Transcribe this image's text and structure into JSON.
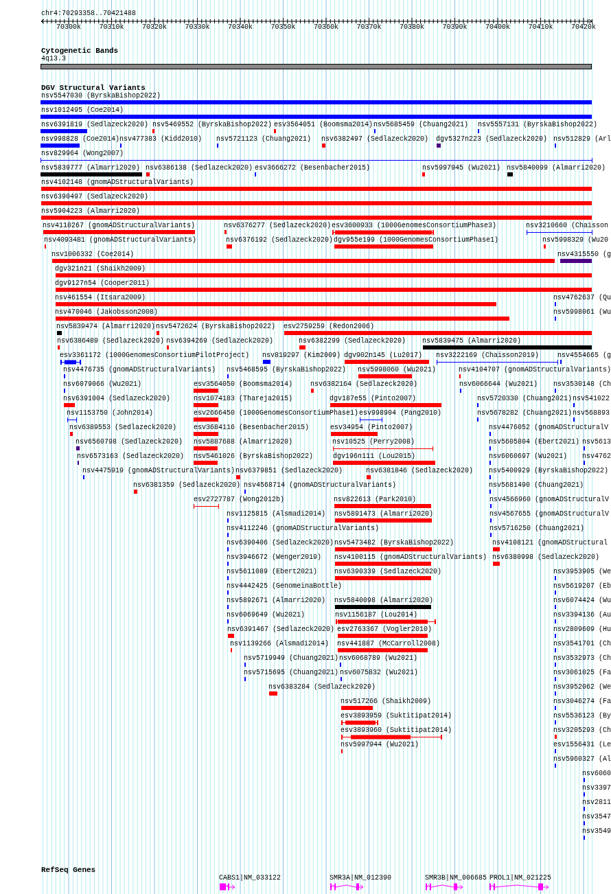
{
  "ruler": {
    "region": "chr4:70293358..70421488",
    "ticks": [
      "70300k",
      "70310k",
      "70320k",
      "70330k",
      "70340k",
      "70350k",
      "70360k",
      "70370k",
      "70380k",
      "70390k",
      "70400k",
      "70410k",
      "70420k"
    ]
  },
  "cytogenetic_bands": {
    "title": "Cytogenetic Bands",
    "band": "4q13.3"
  },
  "variants": {
    "title": "DGV Structural Variants",
    "features": [
      {
        "label": "nsv5547030 (ByrskaBishop2022)",
        "color": "#0000ff",
        "kind": "bar"
      },
      {
        "label": "nsv1012495 (Coe2014)",
        "color": "#0000ff",
        "kind": "bar"
      },
      {
        "label": "nsv6391819 (Sedlazeck2020)",
        "color": "#0000ff",
        "kind": "bar"
      },
      {
        "label": "nsv5469552 (ByrskaBishop2022)",
        "color": "#ff0000",
        "kind": "bar"
      },
      {
        "label": "esv3564051 (Boomsma2014)",
        "color": "#ff0000",
        "kind": "bar"
      },
      {
        "label": "nsv5685459 (Chuang2021)",
        "color": "#0000ff",
        "kind": "bar"
      },
      {
        "label": "nsv5557131 (ByrskaBishop2022)",
        "color": "#0000ff",
        "kind": "bar"
      },
      {
        "label": "nsv998828 (Coe2014)",
        "color": "#0000ff",
        "kind": "bar"
      },
      {
        "label": "nsv477383 (Kidd2010)",
        "color": "#0000ff",
        "kind": "bar"
      },
      {
        "label": "nsv5721123 (Chuang2021)",
        "color": "#0000ff",
        "kind": "bar"
      },
      {
        "label": "nsv6382497 (Sedlazeck2020)",
        "color": "#ff0000",
        "kind": "bar"
      },
      {
        "label": "dgv5327n223 (Sedlazeck2020)",
        "color": "#4b0082",
        "kind": "bar"
      },
      {
        "label": "nsv512829 (Arl",
        "color": "#0000ff",
        "kind": "bar"
      },
      {
        "label": "nsv829964 (Wong2007)",
        "color": "#0000ff",
        "kind": "line"
      },
      {
        "label": "nsv5839777 (Almarri2020)",
        "color": "#000000",
        "kind": "bar"
      },
      {
        "label": "nsv6386138 (Sedlazeck2020)",
        "color": "#ff0000",
        "kind": "bar"
      },
      {
        "label": "esv3666272 (Besenbacher2015)",
        "color": "#0000ff",
        "kind": "bar"
      },
      {
        "label": "nsv5997945 (Wu2021)",
        "color": "#ff0000",
        "kind": "bar"
      },
      {
        "label": "nsv5840099 (Almarri2020)",
        "color": "#000000",
        "kind": "bar"
      },
      {
        "label": "nsv4102148 (gnomADStructuralVariants)",
        "color": "#ff0000",
        "kind": "bar"
      },
      {
        "label": "nsv6390497 (Sedlazeck2020)",
        "color": "#ff0000",
        "kind": "bar"
      },
      {
        "label": "nsv5904223 (Almarri2020)",
        "color": "#ff0000",
        "kind": "bar"
      },
      {
        "label": "nsv4110267 (gnomADStructuralVariants)",
        "color": "#ff0000",
        "kind": "bar"
      },
      {
        "label": "nsv6376277 (Sedlazeck2020)",
        "color": "#ff0000",
        "kind": "bar"
      },
      {
        "label": "esv3600933 (1000GenomesConsortiumPhase3)",
        "color": "#ff0000",
        "kind": "capped-bar"
      },
      {
        "label": "nsv3210660 (Chaisson",
        "color": "#0000ff",
        "kind": "line"
      },
      {
        "label": "nsv4093481 (gnomADStructuralVariants)",
        "color": "#ff0000",
        "kind": "bar"
      },
      {
        "label": "nsv6376192 (Sedlazeck2020)",
        "color": "#ff0000",
        "kind": "bar"
      },
      {
        "label": "dgv955e199 (1000GenomesConsortiumPhase1)",
        "color": "#ff0000",
        "kind": "bar"
      },
      {
        "label": "nsv5998329 (Wu20",
        "color": "#ff0000",
        "kind": "bar"
      },
      {
        "label": "nsv1006332 (Coe2014)",
        "color": "#ff0000",
        "kind": "bar"
      },
      {
        "label": "nsv4315550 (g",
        "color": "#4b0082",
        "kind": "bar"
      },
      {
        "label": "dgv321n21 (Shaikh2009)",
        "color": "#ff0000",
        "kind": "bar"
      },
      {
        "label": "dgv9127n54 (Cooper2011)",
        "color": "#ff0000",
        "kind": "bar"
      },
      {
        "label": "nsv461554 (Itsara2009)",
        "color": "#ff0000",
        "kind": "bar"
      },
      {
        "label": "nsv4762637 (Qu",
        "color": "#0000ff",
        "kind": "bar"
      },
      {
        "label": "nsv470046 (Jakobsson2008)",
        "color": "#ff0000",
        "kind": "bar"
      },
      {
        "label": "nsv5998061 (Wu",
        "color": "#0000ff",
        "kind": "bar"
      },
      {
        "label": "nsv5839474 (Almarri2020)",
        "color": "#000000",
        "kind": "bar"
      },
      {
        "label": "nsv5472624 (ByrskaBishop2022)",
        "color": "#ff0000",
        "kind": "bar"
      },
      {
        "label": "esv2759259 (Redon2006)",
        "color": "#ff0000",
        "kind": "bar"
      },
      {
        "label": "nsv6386489 (Sedlazeck2020)",
        "color": "#ff0000",
        "kind": "bar"
      },
      {
        "label": "nsv6394269 (Sedlazeck2020)",
        "color": "#ff0000",
        "kind": "bar"
      },
      {
        "label": "nsv6382299 (Sedlazeck2020)",
        "color": "#ff0000",
        "kind": "bar"
      },
      {
        "label": "nsv5839475 (Almarri2020)",
        "color": "#000000",
        "kind": "bar"
      },
      {
        "label": "esv3361172 (1000GenomesConsortiumPilotProject)",
        "color": "#0000ff",
        "kind": "capped-bar"
      },
      {
        "label": "nsv819297 (Kim2009)",
        "color": "#0000ff",
        "kind": "bar"
      },
      {
        "label": "dgv902n145 (Lu2017)",
        "color": "#ff0000",
        "kind": "bar"
      },
      {
        "label": "nsv3222169 (Chaisson2019)",
        "color": "#0000ff",
        "kind": "line"
      },
      {
        "label": "nsv4554665 (g",
        "color": "#0000ff",
        "kind": "bar"
      },
      {
        "label": "nsv4476735 (gnomADStructuralVariants)",
        "color": "#0000ff",
        "kind": "bar"
      },
      {
        "label": "nsv5468595 (ByrskaBishop2022)",
        "color": "#0000ff",
        "kind": "bar"
      },
      {
        "label": "nsv5998060 (Wu2021)",
        "color": "#ff0000",
        "kind": "bar"
      },
      {
        "label": "nsv4104707 (gnomADStructuralVariants)",
        "color": "#ff0000",
        "kind": "bar"
      },
      {
        "label": "nsv6079066 (Wu2021)",
        "color": "#0000ff",
        "kind": "bar"
      },
      {
        "label": "esv3564050 (Boomsma2014)",
        "color": "#ff0000",
        "kind": "bar"
      },
      {
        "label": "nsv6382164 (Sedlazeck2020)",
        "color": "#ff0000",
        "kind": "bar"
      },
      {
        "label": "nsv6066644 (Wu2021)",
        "color": "#0000ff",
        "kind": "bar"
      },
      {
        "label": "nsv3530148 (Ch",
        "color": "#0000ff",
        "kind": "bar"
      },
      {
        "label": "nsv6391004 (Sedlazeck2020)",
        "color": "#ff0000",
        "kind": "bar"
      },
      {
        "label": "nsv1074183 (Thareja2015)",
        "color": "#ff0000",
        "kind": "bar"
      },
      {
        "label": "dgv187e55 (Pinto2007)",
        "color": "#ff0000",
        "kind": "bar"
      },
      {
        "label": "nsv5720330 (Chuang2021)",
        "color": "#0000ff",
        "kind": "bar"
      },
      {
        "label": "nsv541022",
        "color": "#0000ff",
        "kind": "bar"
      },
      {
        "label": "nsv1153750 (John2014)",
        "color": "#0000ff",
        "kind": "line"
      },
      {
        "label": "esv2666450 (1000GenomesConsortiumPhase1)",
        "color": "#ff0000",
        "kind": "bar"
      },
      {
        "label": "esv998904 (Pang2010)",
        "color": "#0000ff",
        "kind": "line"
      },
      {
        "label": "nsv5678282 (Chuang2021)",
        "color": "#0000ff",
        "kind": "bar"
      },
      {
        "label": "nsv568893",
        "color": "#0000ff",
        "kind": "bar"
      },
      {
        "label": "nsv6389553 (Sedlazeck2020)",
        "color": "#ff0000",
        "kind": "bar"
      },
      {
        "label": "esv3684116 (Besenbacher2015)",
        "color": "#ff0000",
        "kind": "bar"
      },
      {
        "label": "esv34954 (Pinto2007)",
        "color": "#ff0000",
        "kind": "bar"
      },
      {
        "label": "nsv4476052 (gnomADStructuralV",
        "color": "#0000ff",
        "kind": "bar"
      },
      {
        "label": "nsv6560798 (Sedlazeck2020)",
        "color": "#4b0082",
        "kind": "bar"
      },
      {
        "label": "nsv5887688 (Almarri2020)",
        "color": "#ff0000",
        "kind": "bar"
      },
      {
        "label": "nsv10525 (Perry2008)",
        "color": "#ff0000",
        "kind": "line"
      },
      {
        "label": "nsv5605804 (Ebert2021)",
        "color": "#0000ff",
        "kind": "bar"
      },
      {
        "label": "nsv5613",
        "color": "#0000ff",
        "kind": "bar"
      },
      {
        "label": "nsv6573163 (Sedlazeck2020)",
        "color": "#4b0082",
        "kind": "bar"
      },
      {
        "label": "nsv5461026 (ByrskaBishop2022)",
        "color": "#ff0000",
        "kind": "bar"
      },
      {
        "label": "dgv196n111 (Lou2015)",
        "color": "#ff0000",
        "kind": "bar"
      },
      {
        "label": "nsv6060697 (Wu2021)",
        "color": "#0000ff",
        "kind": "bar"
      },
      {
        "label": "nsv4762",
        "color": "#0000ff",
        "kind": "bar"
      },
      {
        "label": "nsv4475919 (gnomADStructuralVariants)",
        "color": "#0000ff",
        "kind": "bar"
      },
      {
        "label": "nsv6379851 (Sedlazeck2020)",
        "color": "#ff0000",
        "kind": "bar"
      },
      {
        "label": "nsv6381846 (Sedlazeck2020)",
        "color": "#ff0000",
        "kind": "bar"
      },
      {
        "label": "nsv5400929 (ByrskaBishop2022)",
        "color": "#0000ff",
        "kind": "bar"
      },
      {
        "label": "nsv6381359 (Sedlazeck2020)",
        "color": "#ff0000",
        "kind": "bar"
      },
      {
        "label": "nsv4568714 (gnomADStructuralVariants)",
        "color": "#0000ff",
        "kind": "bar"
      },
      {
        "label": "nsv5681490 (Chuang2021)",
        "color": "#0000ff",
        "kind": "bar"
      },
      {
        "label": "esv2727787 (Wong2012b)",
        "color": "#ff0000",
        "kind": "line"
      },
      {
        "label": "nsv822613 (Park2010)",
        "color": "#ff0000",
        "kind": "bar"
      },
      {
        "label": "nsv4566960 (gnomADStructuralV",
        "color": "#0000ff",
        "kind": "bar"
      },
      {
        "label": "nsv1125815 (Alsmadi2014)",
        "color": "#0000ff",
        "kind": "bar"
      },
      {
        "label": "nsv5891473 (Almarri2020)",
        "color": "#ff0000",
        "kind": "bar"
      },
      {
        "label": "nsv4567655 (gnomADStructuralV",
        "color": "#0000ff",
        "kind": "bar"
      },
      {
        "label": "nsv4112246 (gnomADStructuralVariants)",
        "color": "#0000ff",
        "kind": "bar"
      },
      {
        "label": "nsv5716250 (Chuang2021)",
        "color": "#0000ff",
        "kind": "bar"
      },
      {
        "label": "nsv6390406 (Sedlazeck2020)",
        "color": "#0000ff",
        "kind": "bar"
      },
      {
        "label": "nsv5473482 (ByrskaBishop2022)",
        "color": "#ff0000",
        "kind": "bar"
      },
      {
        "label": "nsv4108121 (gnomADStructural",
        "color": "#ff0000",
        "kind": "bar"
      },
      {
        "label": "nsv3946672 (Wenger2019)",
        "color": "#0000ff",
        "kind": "bar"
      },
      {
        "label": "nsv4100115 (gnomADStructuralVariants)",
        "color": "#ff0000",
        "kind": "bar"
      },
      {
        "label": "nsv6380998 (Sedlazeck2020)",
        "color": "#ff0000",
        "kind": "bar"
      },
      {
        "label": "nsv5611089 (Ebert2021)",
        "color": "#0000ff",
        "kind": "bar"
      },
      {
        "label": "nsv6390339 (Sedlazeck2020)",
        "color": "#ff0000",
        "kind": "bar"
      },
      {
        "label": "nsv3953905 (We",
        "color": "#0000ff",
        "kind": "bar"
      },
      {
        "label": "nsv4442425 (GenomeinaBottle)",
        "color": "#0000ff",
        "kind": "bar"
      },
      {
        "label": "nsv5619207 (Eb",
        "color": "#0000ff",
        "kind": "bar"
      },
      {
        "label": "nsv5892671 (Almarri2020)",
        "color": "#0000ff",
        "kind": "bar"
      },
      {
        "label": "nsv5840098 (Almarri2020)",
        "color": "#000000",
        "kind": "bar"
      },
      {
        "label": "nsv6074424 (Wu",
        "color": "#0000ff",
        "kind": "bar"
      },
      {
        "label": "nsv6069649 (Wu2021)",
        "color": "#0000ff",
        "kind": "bar"
      },
      {
        "label": "nsv1156187 (Lou2014)",
        "color": "#ff0000",
        "kind": "capped-bar"
      },
      {
        "label": "nsv3394136 (Au",
        "color": "#0000ff",
        "kind": "bar"
      },
      {
        "label": "nsv6391467 (Sedlazeck2020)",
        "color": "#ff0000",
        "kind": "bar"
      },
      {
        "label": "esv2763367 (Vogler2010)",
        "color": "#ff0000",
        "kind": "bar"
      },
      {
        "label": "nsv2809609 (Hu",
        "color": "#0000ff",
        "kind": "bar"
      },
      {
        "label": "nsv1139266 (Alsmadi2014)",
        "color": "#ff0000",
        "kind": "bar"
      },
      {
        "label": "nsv441887 (McCarroll2008)",
        "color": "#ff0000",
        "kind": "bar"
      },
      {
        "label": "nsv3541701 (Ch",
        "color": "#0000ff",
        "kind": "bar"
      },
      {
        "label": "nsv5719949 (Chuang2021)",
        "color": "#0000ff",
        "kind": "bar"
      },
      {
        "label": "nsv6068789 (Wu2021)",
        "color": "#0000ff",
        "kind": "bar"
      },
      {
        "label": "nsv3532973 (Ch",
        "color": "#0000ff",
        "kind": "bar"
      },
      {
        "label": "nsv5715695 (Chuang2021)",
        "color": "#0000ff",
        "kind": "bar"
      },
      {
        "label": "nsv6075832 (Wu2021)",
        "color": "#0000ff",
        "kind": "bar"
      },
      {
        "label": "nsv3061025 (Fa",
        "color": "#0000ff",
        "kind": "bar"
      },
      {
        "label": "nsv6383284 (Sedlazeck2020)",
        "color": "#ff0000",
        "kind": "bar"
      },
      {
        "label": "nsv3952062 (We",
        "color": "#0000ff",
        "kind": "bar"
      },
      {
        "label": "nsv517266 (Shaikh2009)",
        "color": "#ff0000",
        "kind": "bar"
      },
      {
        "label": "nsv3046274 (Fa",
        "color": "#0000ff",
        "kind": "bar"
      },
      {
        "label": "esv3893959 (Suktitipat2014)",
        "color": "#ff0000",
        "kind": "capped-bar"
      },
      {
        "label": "nsv5536123 (By",
        "color": "#0000ff",
        "kind": "bar"
      },
      {
        "label": "esv3893960 (Suktitipat2014)",
        "color": "#ff0000",
        "kind": "capped-bar"
      },
      {
        "label": "nsv3205293 (Ch",
        "color": "#ff0000",
        "kind": "bar"
      },
      {
        "label": "nsv5997944 (Wu2021)",
        "color": "#ff0000",
        "kind": "bar"
      },
      {
        "label": "esv1556431 (Le",
        "color": "#0000ff",
        "kind": "bar"
      },
      {
        "label": "nsv5960327 (Al",
        "color": "#0000ff",
        "kind": "bar"
      },
      {
        "label": "nsv6060",
        "color": "#0000ff",
        "kind": "bar"
      },
      {
        "label": "nsv3397",
        "color": "#0000ff",
        "kind": "bar"
      },
      {
        "label": "nsv2811",
        "color": "#0000ff",
        "kind": "bar"
      },
      {
        "label": "nsv3547",
        "color": "#0000ff",
        "kind": "bar"
      },
      {
        "label": "nsv3549",
        "color": "#0000ff",
        "kind": "bar"
      }
    ]
  },
  "genes": {
    "title": "RefSeq Genes",
    "items": [
      {
        "label": "CABS1|NM_033122"
      },
      {
        "label": "SMR3A|NM_012390"
      },
      {
        "label": "SMR3B|NM_006685"
      },
      {
        "label": "PROL1|NM_021225"
      }
    ]
  }
}
